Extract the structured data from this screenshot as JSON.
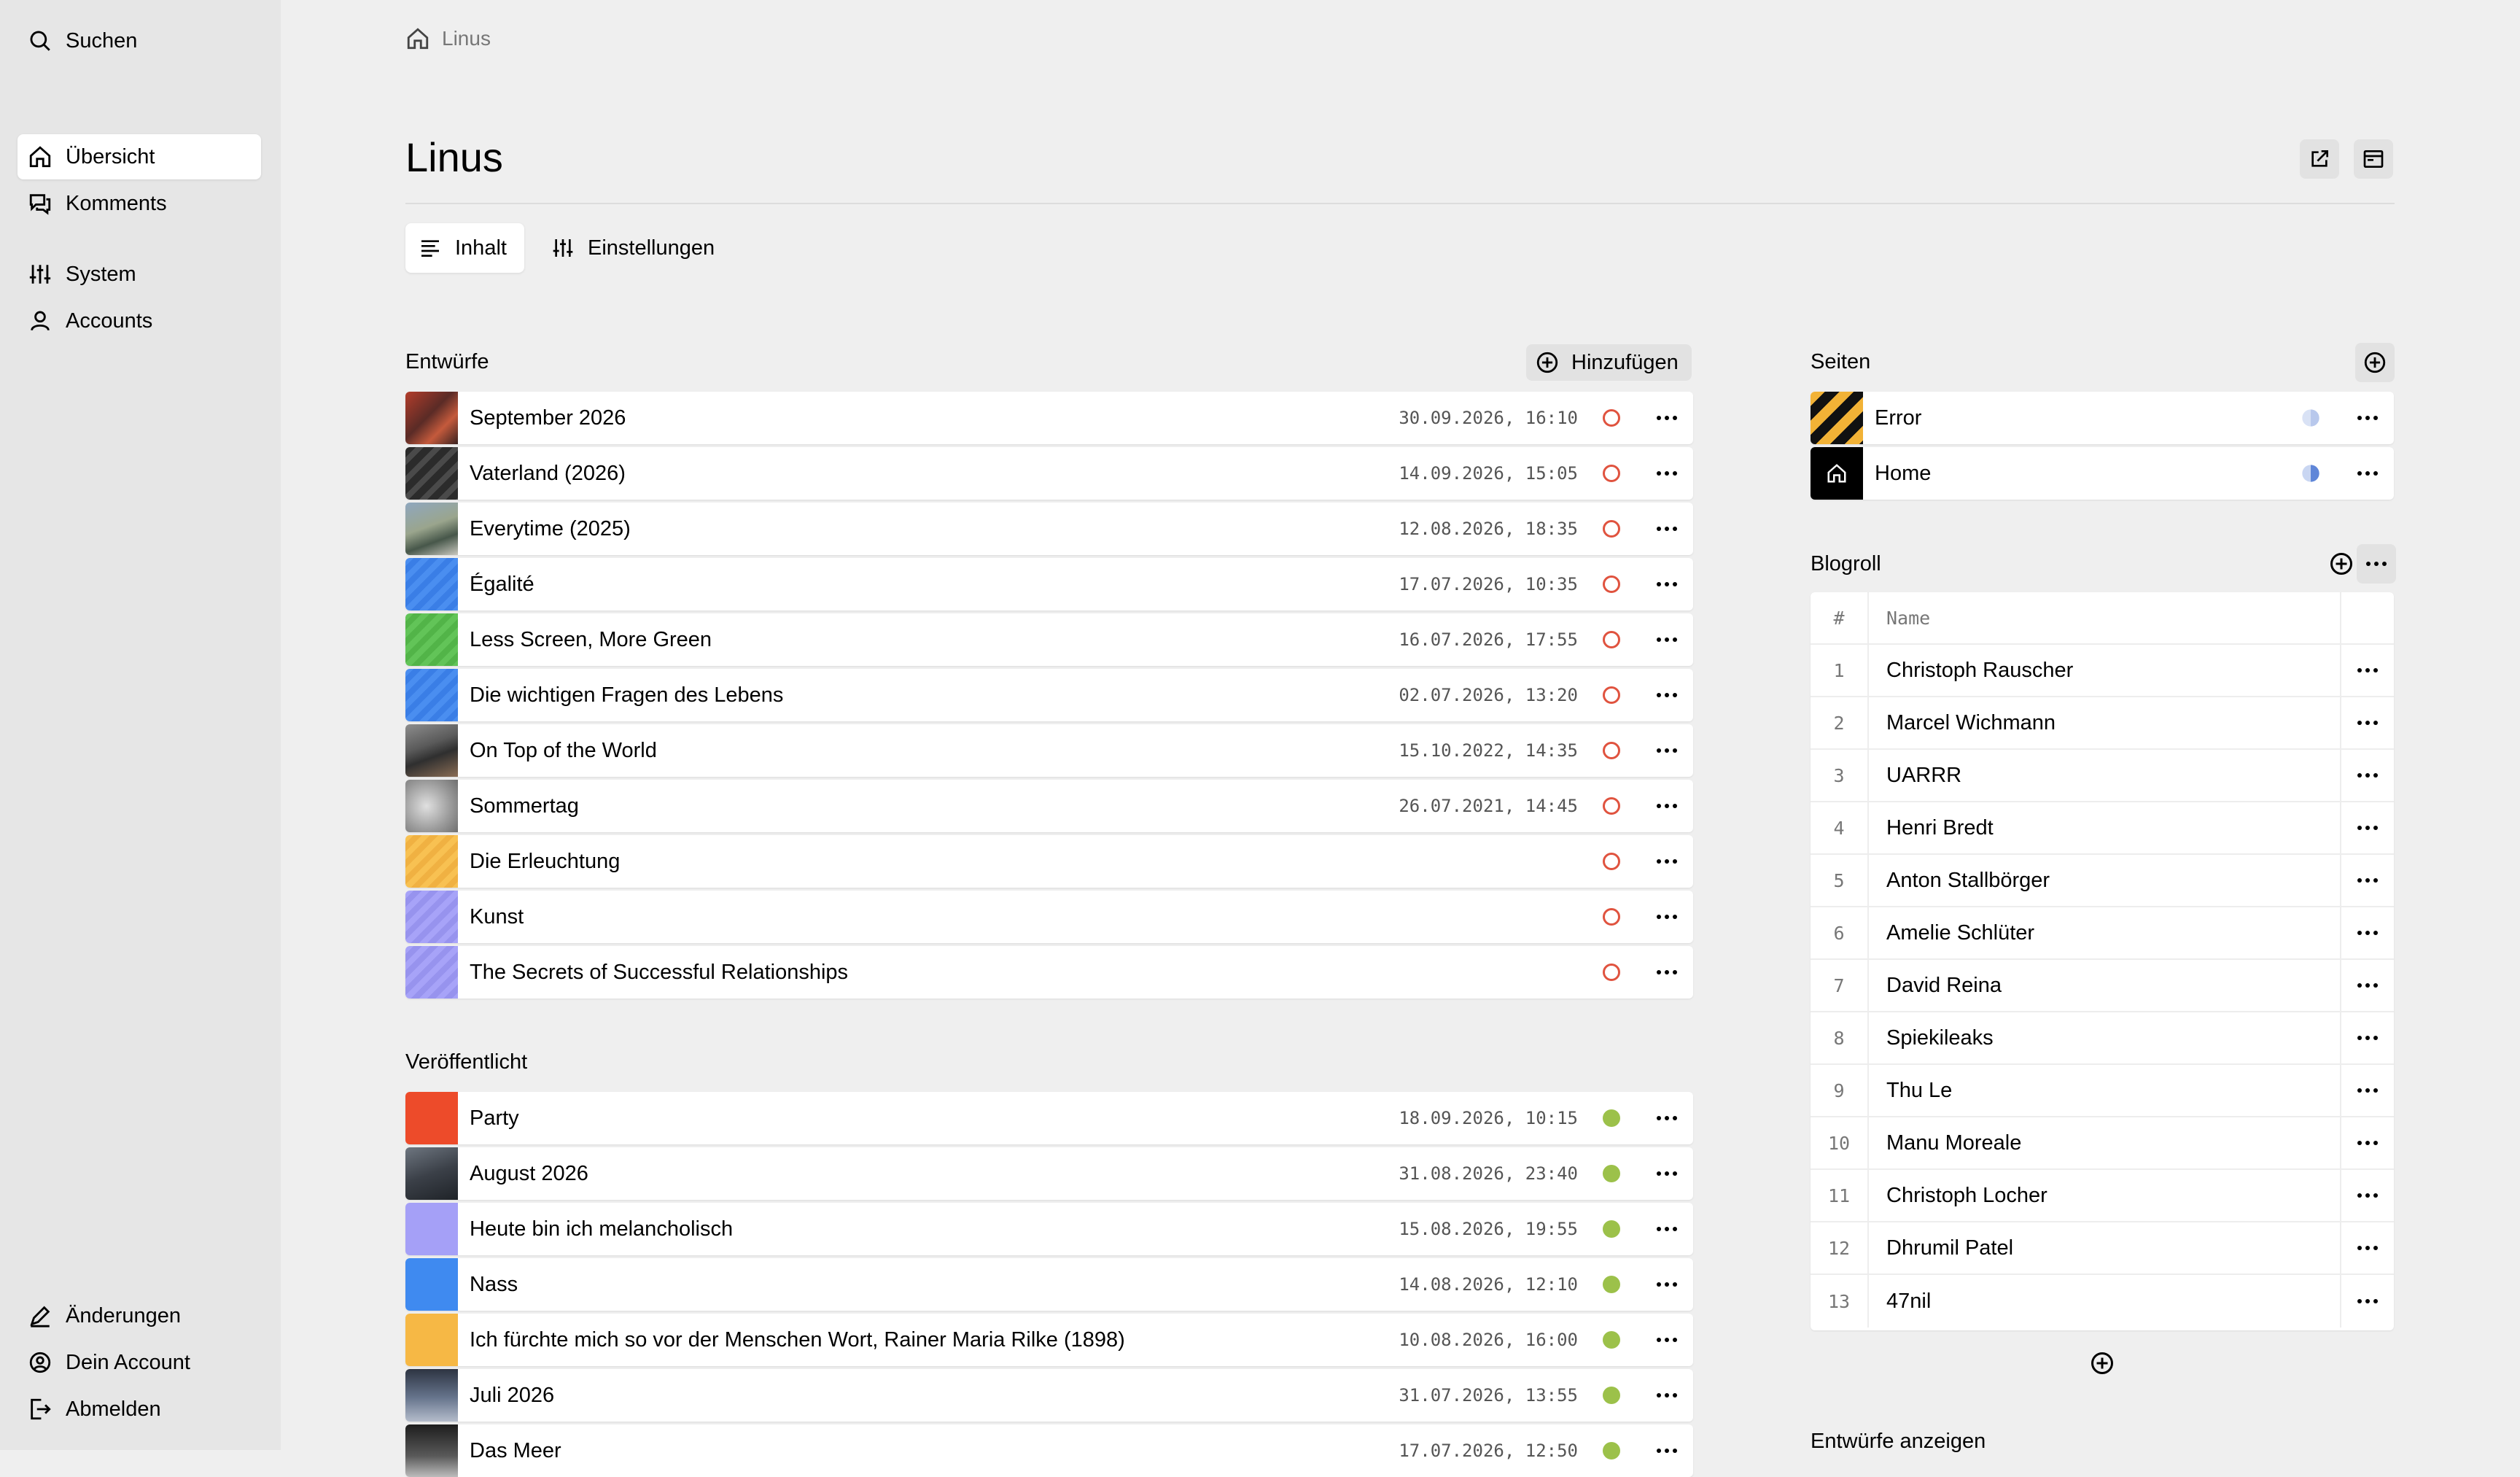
{
  "sidebar": {
    "search_label": "Suchen",
    "items": [
      {
        "label": "Übersicht",
        "icon": "home-icon",
        "active": true
      },
      {
        "label": "Komments",
        "icon": "comments-icon"
      },
      {
        "label": "System",
        "icon": "system-icon"
      },
      {
        "label": "Accounts",
        "icon": "accounts-icon"
      }
    ],
    "footer": [
      {
        "label": "Änderungen",
        "icon": "edit-icon"
      },
      {
        "label": "Dein Account",
        "icon": "account-icon"
      },
      {
        "label": "Abmelden",
        "icon": "logout-icon"
      }
    ]
  },
  "breadcrumb": {
    "icon": "home-icon",
    "label": "Linus"
  },
  "page": {
    "title": "Linus",
    "tabs": [
      {
        "label": "Inhalt",
        "icon": "lines-icon",
        "active": true
      },
      {
        "label": "Einstellungen",
        "icon": "sliders-icon"
      }
    ]
  },
  "drafts": {
    "title": "Entwürfe",
    "add_label": "Hinzufügen",
    "items": [
      {
        "title": "September 2026",
        "date": "30.09.2026, 16:10",
        "thumb": "photo-red"
      },
      {
        "title": "Vaterland (2026)",
        "date": "14.09.2026, 15:05",
        "thumb": "photo-dark"
      },
      {
        "title": "Everytime (2025)",
        "date": "12.08.2026, 18:35",
        "thumb": "photo-landscape"
      },
      {
        "title": "Égalité",
        "date": "17.07.2026, 10:35",
        "thumb": "stripes-blue"
      },
      {
        "title": "Less Screen, More Green",
        "date": "16.07.2026, 17:55",
        "thumb": "stripes-green"
      },
      {
        "title": "Die wichtigen Fragen des Lebens",
        "date": "02.07.2026, 13:20",
        "thumb": "stripes-blue"
      },
      {
        "title": "On Top of the World",
        "date": "15.10.2022, 14:35",
        "thumb": "photo-mountain"
      },
      {
        "title": "Sommertag",
        "date": "26.07.2021, 14:45",
        "thumb": "photo-grey"
      },
      {
        "title": "Die Erleuchtung",
        "date": "",
        "thumb": "stripes-orange"
      },
      {
        "title": "Kunst",
        "date": "",
        "thumb": "stripes-purple"
      },
      {
        "title": "The Secrets of Successful Relationships",
        "date": "",
        "thumb": "stripes-purple"
      }
    ]
  },
  "published": {
    "title": "Veröffentlicht",
    "items": [
      {
        "title": "Party",
        "date": "18.09.2026, 10:15",
        "thumb": "solid-red"
      },
      {
        "title": "August 2026",
        "date": "31.08.2026, 23:40",
        "thumb": "photo-night"
      },
      {
        "title": "Heute bin ich melancholisch",
        "date": "15.08.2026, 19:55",
        "thumb": "solid-purple"
      },
      {
        "title": "Nass",
        "date": "14.08.2026, 12:10",
        "thumb": "solid-blue"
      },
      {
        "title": "Ich fürchte mich so vor der Menschen Wort, Rainer Maria Rilke (1898)",
        "date": "10.08.2026, 16:00",
        "thumb": "solid-orange"
      },
      {
        "title": "Juli 2026",
        "date": "31.07.2026, 13:55",
        "thumb": "photo-sky"
      },
      {
        "title": "Das Meer",
        "date": "17.07.2026, 12:50",
        "thumb": "photo-sea"
      }
    ]
  },
  "pages": {
    "title": "Seiten",
    "items": [
      {
        "title": "Error",
        "thumb": "error-thumb"
      },
      {
        "title": "Home",
        "thumb": "home-thumb",
        "icon": "home-icon"
      }
    ]
  },
  "blogroll": {
    "title": "Blogroll",
    "headers": {
      "num": "#",
      "name": "Name"
    },
    "items": [
      {
        "num": "1",
        "name": "Christoph Rauscher"
      },
      {
        "num": "2",
        "name": "Marcel Wichmann"
      },
      {
        "num": "3",
        "name": "UARRR"
      },
      {
        "num": "4",
        "name": "Henri Bredt"
      },
      {
        "num": "5",
        "name": "Anton Stallbörger"
      },
      {
        "num": "6",
        "name": "Amelie Schlüter"
      },
      {
        "num": "7",
        "name": "David Reina"
      },
      {
        "num": "8",
        "name": "Spiekileaks"
      },
      {
        "num": "9",
        "name": "Thu Le"
      },
      {
        "num": "10",
        "name": "Manu Moreale"
      },
      {
        "num": "11",
        "name": "Christoph Locher"
      },
      {
        "num": "12",
        "name": "Dhrumil Patel"
      },
      {
        "num": "13",
        "name": "47nil"
      }
    ]
  },
  "bottom_section": {
    "title": "Entwürfe anzeigen"
  },
  "colors": {
    "draft_status": "#e0533f",
    "listed_status": "#9cc14a",
    "unlisted_status": "#8ca9e6"
  }
}
